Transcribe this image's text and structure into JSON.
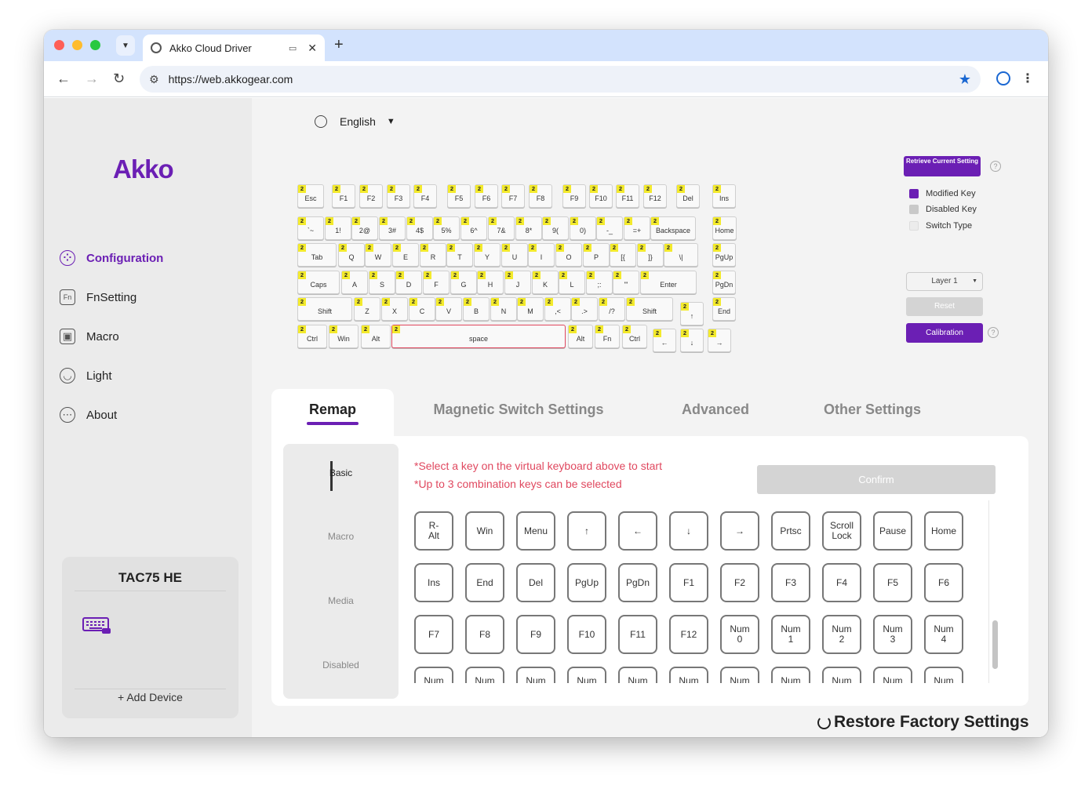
{
  "browser": {
    "tab_title": "Akko Cloud Driver",
    "url": "https://web.akkogear.com",
    "traffic_lights": [
      "#fe5f57",
      "#febc2e",
      "#28c840"
    ]
  },
  "sidebar": {
    "logo": "Akko",
    "items": [
      {
        "label": "Configuration",
        "icon": "dots-grid-icon",
        "active": true
      },
      {
        "label": "FnSetting",
        "icon": "fn-icon",
        "active": false
      },
      {
        "label": "Macro",
        "icon": "chip-icon",
        "active": false
      },
      {
        "label": "Light",
        "icon": "bulb-icon",
        "active": false
      },
      {
        "label": "About",
        "icon": "ellipsis-circle-icon",
        "active": false
      }
    ],
    "device": {
      "name": "TAC75 HE",
      "add_label": "+ Add Device"
    }
  },
  "language": {
    "label": "English"
  },
  "keyboard": {
    "level_badge": "2",
    "selected_key": "space",
    "rows": [
      [
        "Esc",
        "F1",
        "F2",
        "F3",
        "F4",
        "F5",
        "F6",
        "F7",
        "F8",
        "F9",
        "F10",
        "F11",
        "F12",
        "Del",
        "Ins"
      ],
      [
        "`~",
        "1!",
        "2@",
        "3#",
        "4$",
        "5%",
        "6^",
        "7&",
        "8*",
        "9(",
        "0)",
        "-_",
        "=+",
        "Backspace",
        "Home"
      ],
      [
        "Tab",
        "Q",
        "W",
        "E",
        "R",
        "T",
        "Y",
        "U",
        "I",
        "O",
        "P",
        "[{",
        "]}",
        "\\|",
        "PgUp"
      ],
      [
        "Caps",
        "A",
        "S",
        "D",
        "F",
        "G",
        "H",
        "J",
        "K",
        "L",
        ";:",
        "'\"",
        "Enter",
        "PgDn"
      ],
      [
        "Shift",
        "Z",
        "X",
        "C",
        "V",
        "B",
        "N",
        "M",
        ",<",
        ".>",
        "/?",
        "Shift",
        "↑",
        "End"
      ],
      [
        "Ctrl",
        "Win",
        "Alt",
        "space",
        "Alt",
        "Fn",
        "Ctrl",
        "←",
        "↓",
        "→"
      ]
    ]
  },
  "right_panel": {
    "retrieve_label": "Retrieve Current Setting",
    "legend": [
      {
        "label": "Modified Key",
        "color": "#6b1fb4"
      },
      {
        "label": "Disabled Key",
        "color": "#c9c9c9"
      },
      {
        "label": "Switch Type",
        "color": "#ececec"
      }
    ],
    "layer_label": "Layer 1",
    "reset_label": "Reset",
    "calibration_label": "Calibration"
  },
  "tabs": [
    {
      "label": "Remap",
      "active": true
    },
    {
      "label": "Magnetic Switch Settings",
      "active": false
    },
    {
      "label": "Advanced",
      "active": false
    },
    {
      "label": "Other Settings",
      "active": false
    }
  ],
  "remap": {
    "subnav": [
      "Basic",
      "Macro",
      "Media",
      "Disabled"
    ],
    "hint_1": "*Select a key on the virtual keyboard above to start",
    "hint_2": "*Up to 3 combination keys can be selected",
    "confirm_label": "Confirm",
    "keys": [
      [
        "R-\nAlt",
        "Win",
        "Menu",
        "↑",
        "←",
        "↓",
        "→",
        "Prtsc",
        "Scroll\nLock",
        "Pause",
        "Home"
      ],
      [
        "Ins",
        "End",
        "Del",
        "PgUp",
        "PgDn",
        "F1",
        "F2",
        "F3",
        "F4",
        "F5",
        "F6"
      ],
      [
        "F7",
        "F8",
        "F9",
        "F10",
        "F11",
        "F12",
        "Num\n0",
        "Num\n1",
        "Num\n2",
        "Num\n3",
        "Num\n4"
      ],
      [
        "Num",
        "Num",
        "Num",
        "Num",
        "Num",
        "Num",
        "Num",
        "Num",
        "Num",
        "Num",
        "Num"
      ]
    ]
  },
  "restore_label": "Restore Factory Settings"
}
